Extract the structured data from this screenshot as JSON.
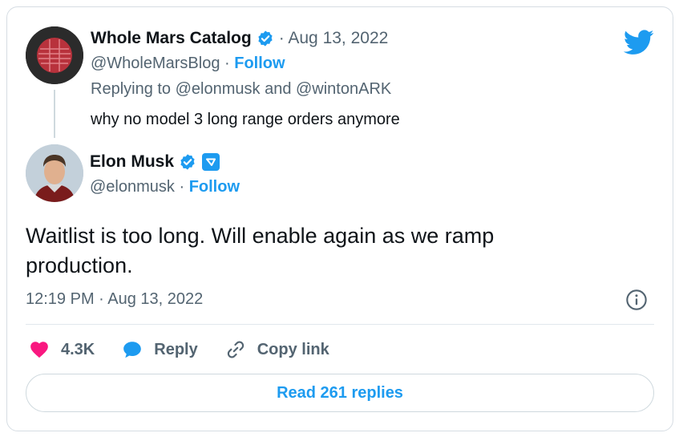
{
  "reply_tweet": {
    "author_name": "Whole Mars Catalog",
    "date": "· Aug 13, 2022",
    "handle": "@WholeMarsBlog",
    "separator": " · ",
    "follow_label": "Follow",
    "replying_to": "Replying to @elonmusk and @wintonARK",
    "text": "why no model 3 long range orders anymore"
  },
  "main_tweet": {
    "author_name": "Elon Musk",
    "handle": "@elonmusk",
    "separator": " · ",
    "follow_label": "Follow",
    "text": "Waitlist is too long. Will enable again as we ramp production.",
    "timestamp": "12:19 PM · Aug 13, 2022"
  },
  "actions": {
    "likes": "4.3K",
    "reply_label": "Reply",
    "copy_link_label": "Copy link"
  },
  "read_replies_label": "Read 261 replies",
  "colors": {
    "accent": "#1d9bf0",
    "like": "#f91880",
    "muted": "#536471",
    "text": "#0f1419"
  },
  "icons": [
    "twitter-bird-icon",
    "verified-badge-icon",
    "government-badge-icon",
    "info-icon",
    "heart-icon",
    "reply-bubble-icon",
    "link-icon"
  ]
}
